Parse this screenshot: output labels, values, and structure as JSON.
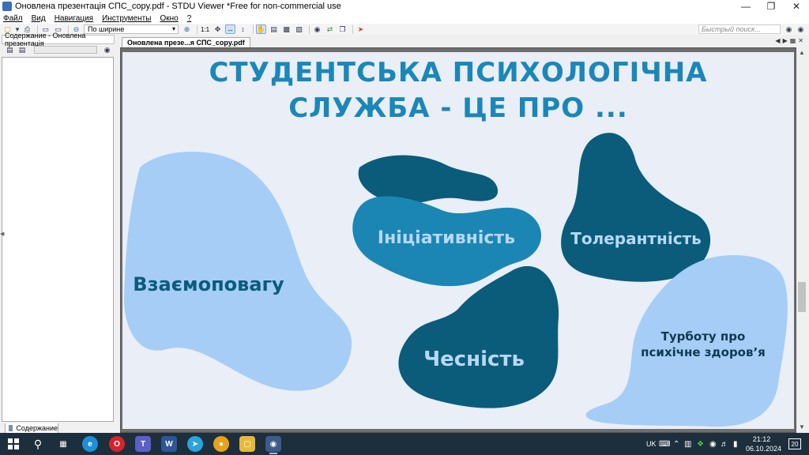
{
  "window": {
    "title": "Оновлена презентація СПС_copy.pdf - STDU Viewer *Free for non-commercial use"
  },
  "menu": [
    "Файл",
    "Вид",
    "Навигация",
    "Инструменты",
    "Окно",
    "?"
  ],
  "toolbar": {
    "one_to_one": "1:1",
    "zoom_value": "По ширине",
    "quick_search_placeholder": "Быстрый поиск..."
  },
  "left_panel": {
    "header": "Содержание - Оновлена презентація",
    "tab_label": "Содержание"
  },
  "document": {
    "tab_label": "Оновлена презе...я СПС_copy.pdf"
  },
  "slide": {
    "title_line1": "СТУДЕНТСЬКА ПСИХОЛОГІЧНА",
    "title_line2": "СЛУЖБА - ЦЕ ПРО ...",
    "labels": {
      "respect": "Взаємоповагу",
      "initiative": "Ініціативність",
      "tolerance": "Толерантність",
      "honesty": "Чесність",
      "care_line1": "Турботу про",
      "care_line2": "психічне здоров’я"
    },
    "colors": {
      "background": "#e9eef7",
      "title": "#1a87b8",
      "dark_teal": "#0a5c7a",
      "mid_blue": "#1b86b3",
      "light_blue": "#a6cdf5"
    }
  },
  "taskbar": {
    "language": "UK",
    "time": "21:12",
    "date": "06.10.2024",
    "notifications": "20"
  }
}
